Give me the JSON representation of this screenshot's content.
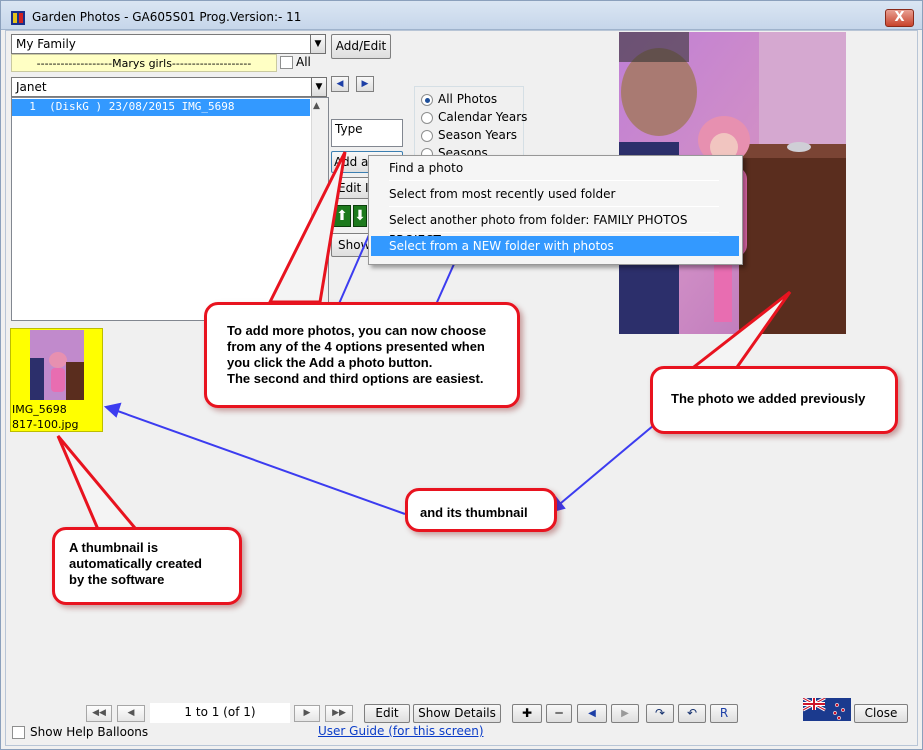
{
  "window": {
    "title": "Garden Photos - GA605S01   Prog.Version:-  11",
    "close_glyph": "X"
  },
  "family_combo": {
    "value": "My Family"
  },
  "add_edit_button": "Add/Edit",
  "group_label": "-------------------Marys girls--------------------",
  "all_checkbox_label": "All",
  "person_combo": {
    "value": "Janet"
  },
  "photo_list": {
    "rows": [
      "  1  (DiskG ) 23/08/2015 IMG_5698"
    ]
  },
  "filter_options": [
    "All Photos",
    "Calendar Years",
    "Season Years",
    "Seasons"
  ],
  "type_label": "Type",
  "add_photo_button": "Add a",
  "edit_button_partial": "Edit I",
  "show_button_partial": "Show",
  "context_menu": {
    "items": [
      "Find a photo",
      "Select from most recently used folder",
      "Select another photo from folder: FAMILY PHOTOS PROJECT",
      "Select from a NEW folder with photos"
    ],
    "highlighted_index": 3
  },
  "thumbnail": {
    "line1": "IMG_5698",
    "line2": "817-100.jpg"
  },
  "balloons": {
    "options": "To add more photos, you can now choose\nfrom any of the 4 options presented when\nyou click the Add a photo button.\nThe second and third options are easiest.",
    "previous": "The photo we added previously",
    "its_thumb": "and its thumbnail",
    "auto": "A thumbnail is\nautomatically created\nby the software"
  },
  "bottom_bar": {
    "page_status": "1 to 1 (of 1)",
    "edit_label": "Edit",
    "show_details_label": "Show Details",
    "r_label": "R",
    "close_label": "Close",
    "help_checkbox_label": "Show Help Balloons",
    "user_guide_link": "User Guide (for this screen)"
  },
  "colors": {
    "accent_red": "#e8131f",
    "arrow_blue": "#3c3cf0",
    "selection_blue": "#3399ff",
    "thumb_yellow": "#ffff00"
  }
}
